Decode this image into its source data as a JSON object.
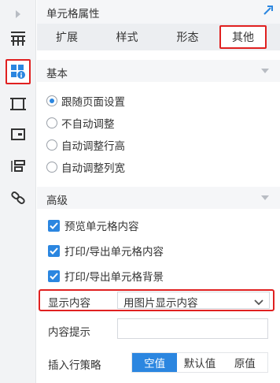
{
  "header": {
    "title": "单元格属性"
  },
  "tabs": [
    {
      "label": "扩展"
    },
    {
      "label": "样式"
    },
    {
      "label": "形态"
    },
    {
      "label": "其他"
    }
  ],
  "active_tab": "其他",
  "basic": {
    "title": "基本",
    "options": [
      {
        "label": "跟随页面设置",
        "selected": true
      },
      {
        "label": "不自动调整",
        "selected": false
      },
      {
        "label": "自动调整行高",
        "selected": false
      },
      {
        "label": "自动调整列宽",
        "selected": false
      }
    ]
  },
  "advanced": {
    "title": "高级",
    "checkboxes": [
      {
        "label": "预览单元格内容",
        "checked": true
      },
      {
        "label": "打印/导出单元格内容",
        "checked": true
      },
      {
        "label": "打印/导出单元格背景",
        "checked": true
      }
    ],
    "display_content": {
      "label": "显示内容",
      "value": "用图片显示内容"
    },
    "content_hint": {
      "label": "内容提示",
      "value": ""
    },
    "insert_strategy": {
      "label": "插入行策略",
      "options": [
        "空值",
        "默认值",
        "原值"
      ],
      "selected": "空值"
    }
  },
  "colors": {
    "accent": "#2b86e0",
    "highlight": "#e02020"
  },
  "icons": {
    "rail": [
      "expand-arrow-icon",
      "cell-grid-icon",
      "cell-attribute-icon",
      "frame-icon",
      "widget-icon",
      "layout-icon",
      "link-icon"
    ],
    "header": "pin-icon"
  }
}
